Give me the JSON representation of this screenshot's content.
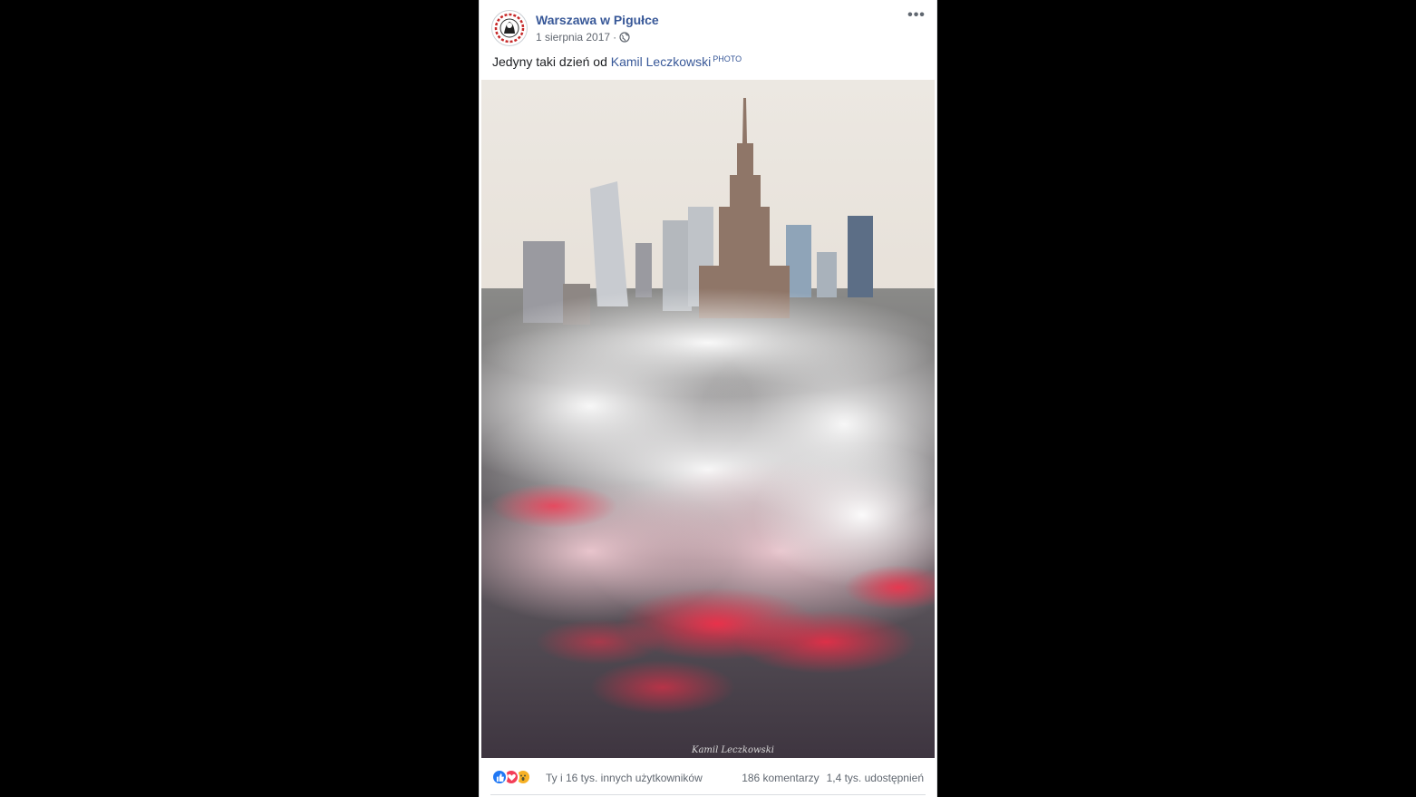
{
  "post": {
    "page_name": "Warszawa w Pigułce",
    "date": "1 sierpnia 2017",
    "separator": "·",
    "more_label": "•••",
    "privacy_icon": "globe-icon",
    "caption": {
      "text": "Jedyny taki dzień od",
      "author_link": "Kamil Leczkowski",
      "tag": "PHOTO"
    },
    "photo": {
      "signature": "Kamil Leczkowski"
    },
    "reactions": {
      "types": [
        "like-icon",
        "love-icon",
        "wow-icon"
      ],
      "summary": "Ty i 16 tys. innych użytkowników",
      "comments": "186 komentarzy",
      "shares": "1,4 tys. udostępnień"
    }
  },
  "colors": {
    "background": "#000000",
    "link": "#385898",
    "like": "#2078f4",
    "love": "#f33e58",
    "wow": "#f7b125",
    "flare_red": "#ff1e3c"
  }
}
